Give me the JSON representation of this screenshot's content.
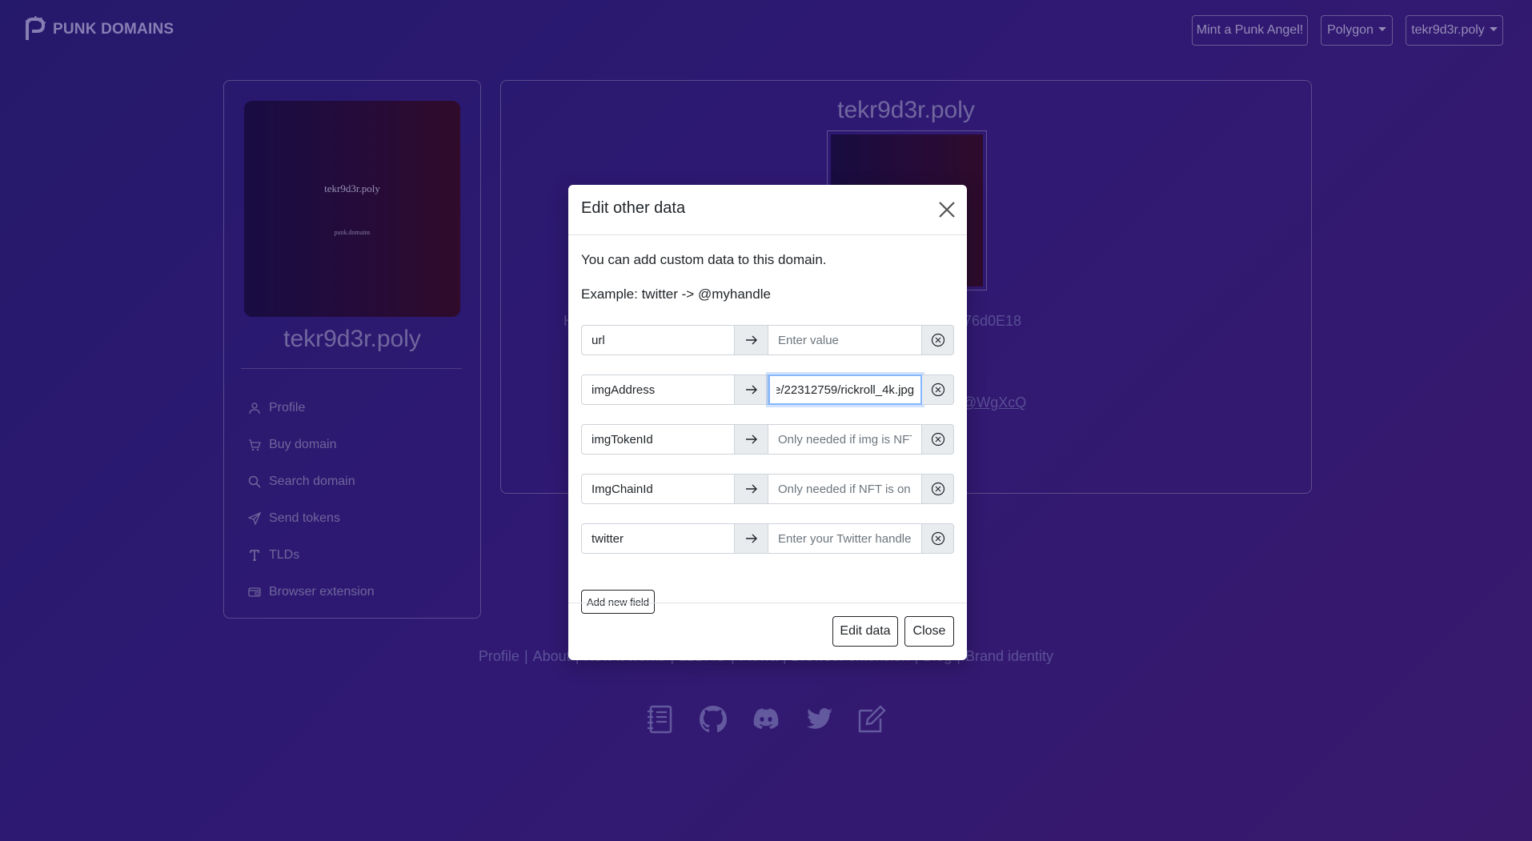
{
  "navbar": {
    "brand": "PUNK DOMAINS",
    "mint_label": "Mint a Punk Angel!",
    "network_label": "Polygon",
    "account_label": "tekr9d3r.poly"
  },
  "sidebar": {
    "nft_name": "tekr9d3r.poly",
    "nft_sub": "punk.domains",
    "domain_name": "tekr9d3r.poly",
    "items": [
      {
        "label": "Profile",
        "icon": "person-icon"
      },
      {
        "label": "Buy domain",
        "icon": "cart-icon"
      },
      {
        "label": "Search domain",
        "icon": "search-icon"
      },
      {
        "label": "Send tokens",
        "icon": "send-icon"
      },
      {
        "label": "TLDs",
        "icon": "type-icon"
      },
      {
        "label": "Browser extension",
        "icon": "extension-icon"
      }
    ]
  },
  "main": {
    "title": "tekr9d3r.poly",
    "holder_fragment": "H",
    "address_fragment": "76d0E18",
    "link_fragment": "@WgXcQ"
  },
  "footer": {
    "links": [
      "Profile",
      "About",
      "How it works",
      "L2DAO",
      "Flowa",
      "Browser extension",
      "Blog",
      "Brand identity"
    ],
    "icons": [
      "journal-icon",
      "github-icon",
      "discord-icon",
      "twitter-icon",
      "edit-icon"
    ]
  },
  "modal": {
    "title": "Edit other data",
    "intro": "You can add custom data to this domain.",
    "example": "Example: twitter -> @myhandle",
    "fields": [
      {
        "key": "url",
        "value": "",
        "placeholder": "Enter value"
      },
      {
        "key": "imgAddress",
        "value": "e/22312759/rickroll_4k.jpg",
        "placeholder": ""
      },
      {
        "key": "imgTokenId",
        "value": "",
        "placeholder": "Only needed if img is NFT"
      },
      {
        "key": "ImgChainId",
        "value": "",
        "placeholder": "Only needed if NFT is on a"
      },
      {
        "key": "twitter",
        "value": "",
        "placeholder": "Enter your Twitter handle"
      }
    ],
    "add_field_label": "Add new field",
    "submit_label": "Edit data",
    "close_label": "Close"
  }
}
